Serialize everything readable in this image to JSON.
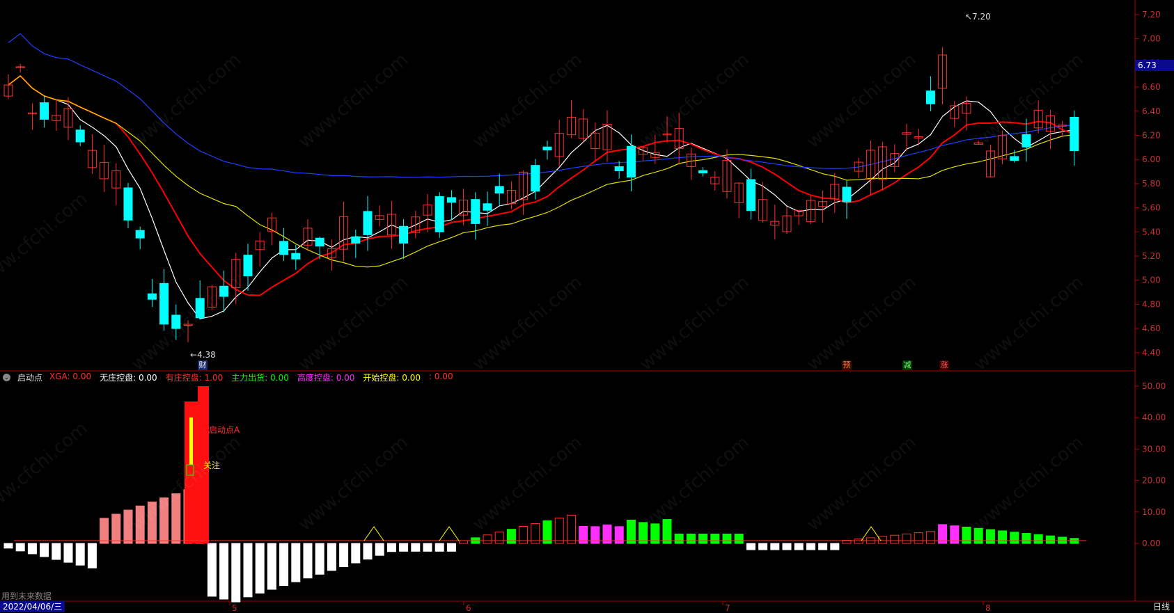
{
  "price_axis": {
    "ticks": [
      "7.20",
      "7.00",
      "6.80",
      "6.60",
      "6.40",
      "6.20",
      "6.00",
      "5.80",
      "5.60",
      "5.40",
      "5.20",
      "5.00",
      "4.80",
      "4.60",
      "4.40"
    ],
    "current_price": "6.73",
    "high_label": "7.20",
    "low_label": "4.38"
  },
  "indicator_axis": {
    "ticks": [
      "50.00",
      "40.00",
      "30.00",
      "20.00",
      "10.00",
      "0.00"
    ]
  },
  "indicator_header": {
    "toggle_icon": "chevron-down-icon",
    "name": "启动点",
    "items": [
      {
        "label": "XGA:",
        "value": "0.00",
        "color": "#ff3030"
      },
      {
        "label": "无庄控盘:",
        "value": "0.00",
        "color": "#ffffff"
      },
      {
        "label": "有庄控盘:",
        "value": "1.00",
        "color": "#ff3030"
      },
      {
        "label": "主力出货:",
        "value": "0.00",
        "color": "#00ff00"
      },
      {
        "label": "高度控盘:",
        "value": "0.00",
        "color": "#ff30ff"
      },
      {
        "label": "开始控盘:",
        "value": "0.00",
        "color": "#ffff00"
      },
      {
        "label": ":",
        "value": "0.00",
        "color": "#ff3030"
      }
    ]
  },
  "annotations": {
    "start_point": "启动点A",
    "attention": "关注",
    "future_data_note": "用到未来数据"
  },
  "event_markers": {
    "cai": "财",
    "yu": "预",
    "jian": "减",
    "zhang": "涨"
  },
  "time_axis": {
    "current_date": "2022/04/06/三",
    "months": [
      "5",
      "6",
      "7",
      "8"
    ],
    "period": "日线"
  },
  "watermark": "www.cfchi.com",
  "colors": {
    "up": "#ff3030",
    "down": "#00ffff",
    "ma5": "#ffffff",
    "ma10": "#ff0000",
    "ma20": "#e0e000",
    "ma60": "#2040ff",
    "panel_border": "#b00000",
    "axis_text": "#c83232"
  }
}
